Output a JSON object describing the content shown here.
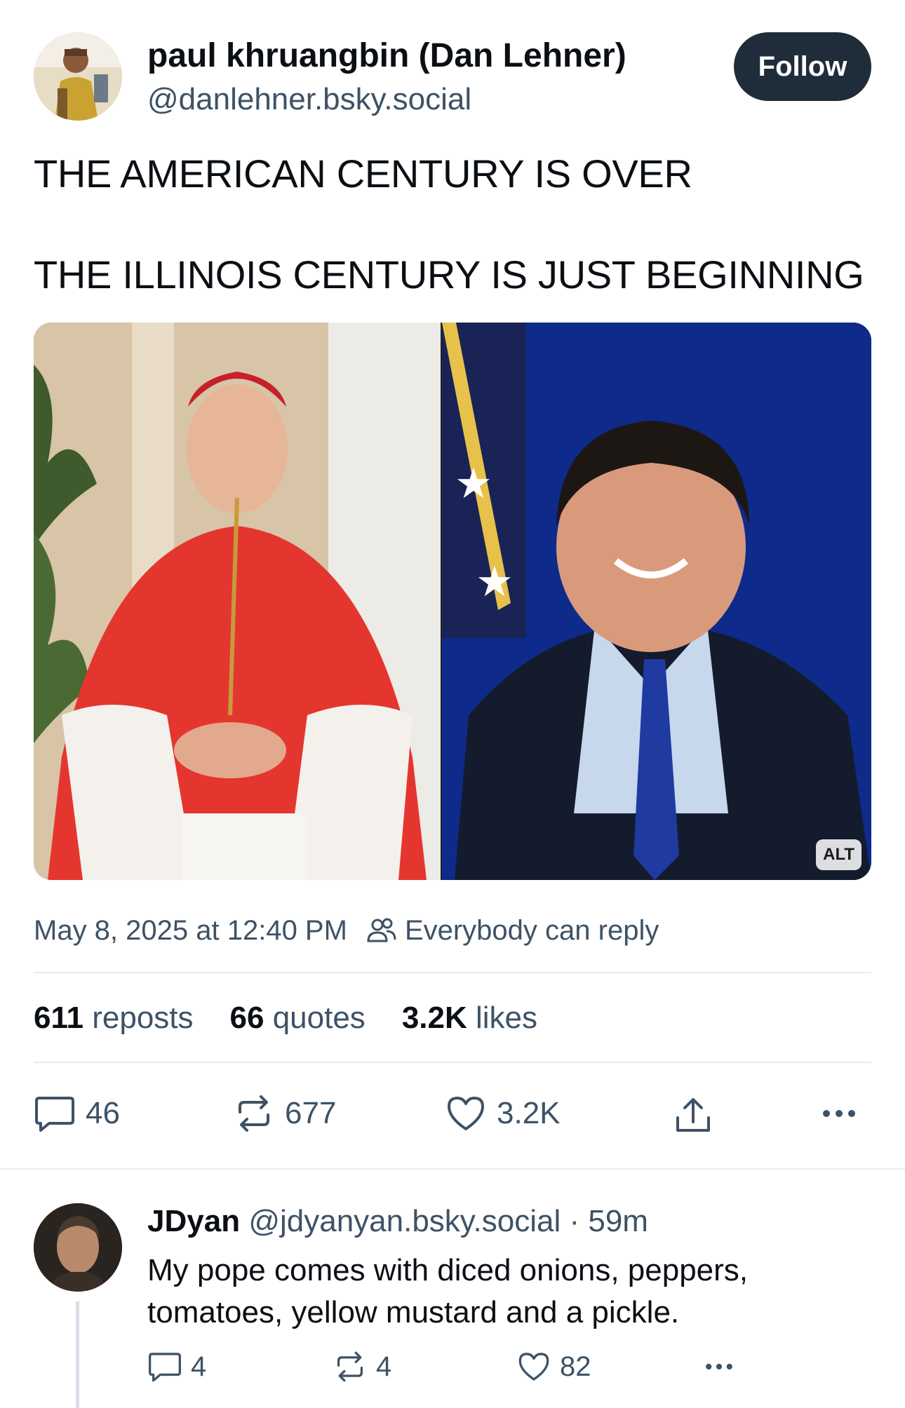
{
  "post": {
    "author": {
      "display_name": "paul khruangbin (Dan Lehner)",
      "handle": "@danlehner.bsky.social"
    },
    "follow_label": "Follow",
    "text_line_1": "THE AMERICAN CENTURY IS OVER",
    "text_line_2": "THE ILLINOIS CENTURY IS JUST BEGINNING",
    "media": {
      "alt_badge": "ALT"
    },
    "timestamp": "May 8, 2025 at 12:40 PM",
    "reply_setting": "Everybody can reply",
    "stats": {
      "reposts_count": "611",
      "reposts_label": "reposts",
      "quotes_count": "66",
      "quotes_label": "quotes",
      "likes_count": "3.2K",
      "likes_label": "likes"
    },
    "actions": {
      "reply_count": "46",
      "repost_count": "677",
      "like_count": "3.2K"
    }
  },
  "reply": {
    "author_name": "JDyan",
    "handle_and_time": "@jdyanyan.bsky.social · 59m",
    "text": "My pope comes with diced onions, peppers, tomatoes, yellow mustard and a pickle.",
    "actions": {
      "reply_count": "4",
      "repost_count": "4",
      "like_count": "82"
    }
  },
  "colors": {
    "text_primary": "#0b0f14",
    "text_secondary": "#3e5266",
    "follow_button_bg": "#1f2d3a",
    "divider": "#e6eaef"
  }
}
